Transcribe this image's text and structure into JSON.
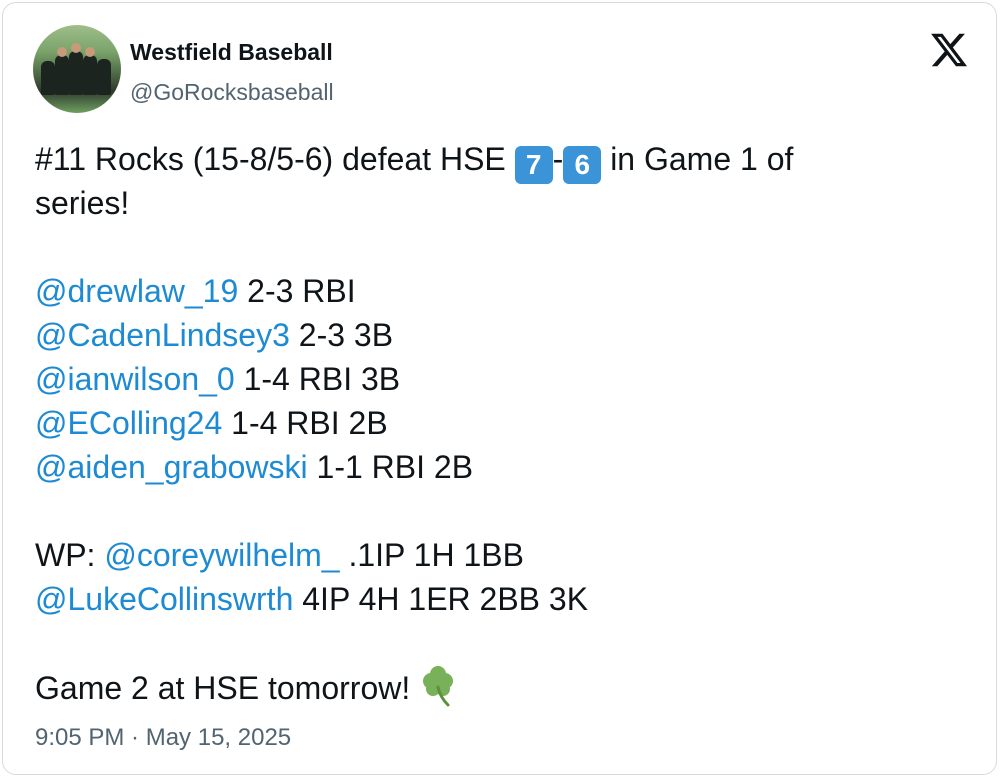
{
  "author": {
    "display_name": "Westfield Baseball",
    "handle": "@GoRocksbaseball"
  },
  "tweet": {
    "headline_pre": "#11 Rocks (15-8/5-6) defeat HSE ",
    "score_home": "7",
    "score_sep": "-",
    "score_away": "6",
    "headline_post": " in Game 1 of",
    "headline_line2": "series!",
    "batters": [
      {
        "mention": "@drewlaw_19",
        "stats": " 2-3 RBI"
      },
      {
        "mention": "@CadenLindsey3",
        "stats": " 2-3 3B"
      },
      {
        "mention": "@ianwilson_0",
        "stats": " 1-4 RBI 3B"
      },
      {
        "mention": "@EColling24",
        "stats": " 1-4 RBI 2B"
      },
      {
        "mention": "@aiden_grabowski",
        "stats": " 1-1 RBI 2B"
      }
    ],
    "wp_label": "WP: ",
    "wp_mention": "@coreywilhelm_",
    "wp_stats": " .1IP 1H 1BB",
    "pitcher2_mention": "@LukeCollinswrth",
    "pitcher2_stats": " 4IP 4H 1ER 2BB 3K",
    "closing": "Game 2 at HSE tomorrow!",
    "closing_emoji": "shamrock-icon"
  },
  "timestamp": "9:05 PM · May 15, 2025",
  "icons": {
    "platform": "x-logo-icon"
  },
  "colors": {
    "mention": "#1d8ad4",
    "keycap": "#3b93d8",
    "text": "#0f1419",
    "muted": "#536471"
  }
}
